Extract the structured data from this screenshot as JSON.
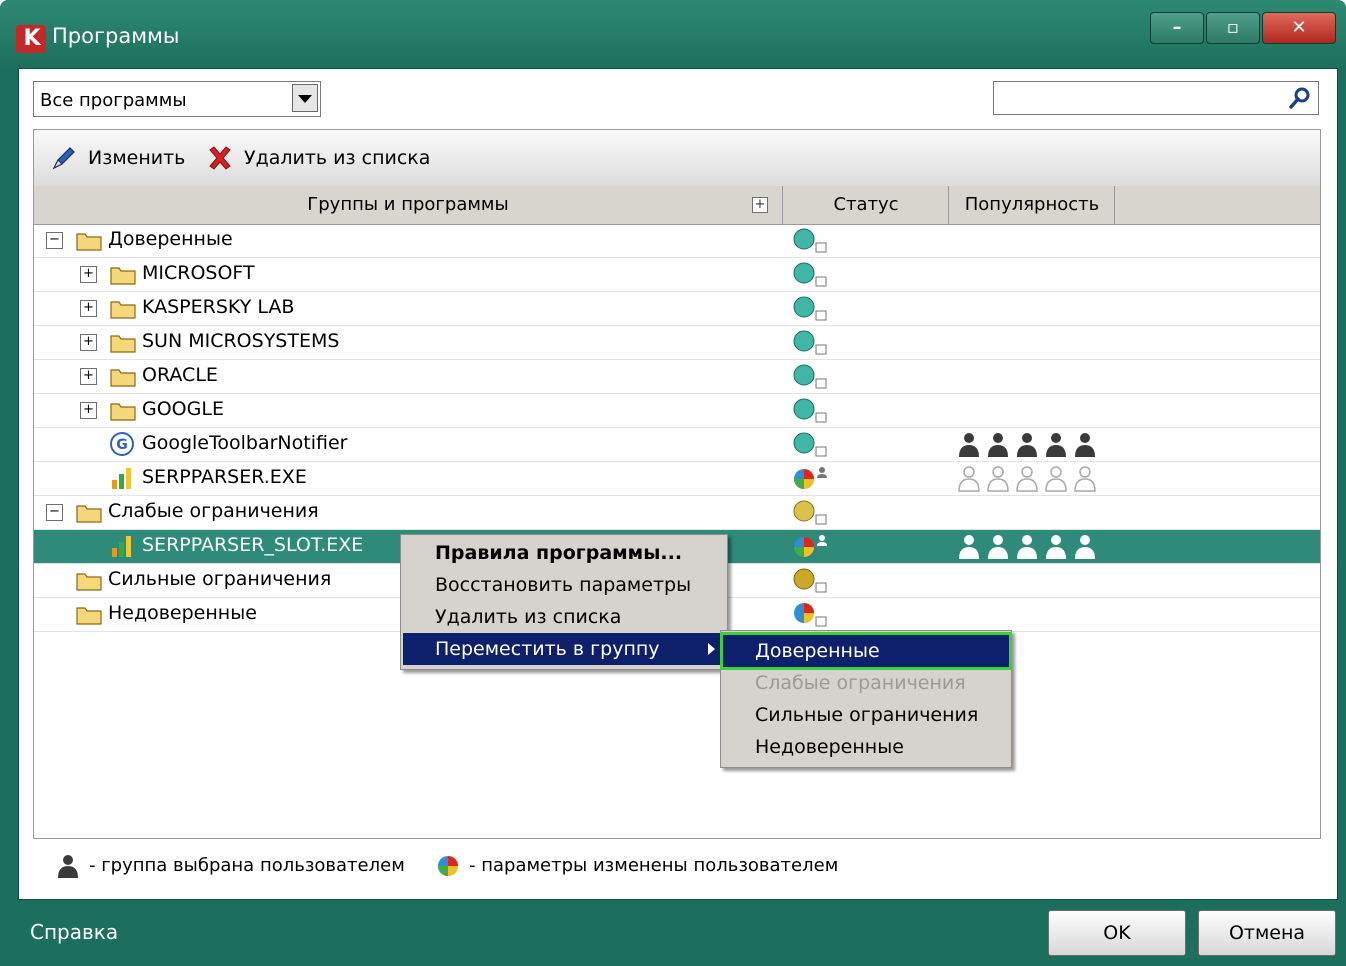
{
  "window": {
    "title": "Программы"
  },
  "filter": {
    "selected": "Все программы"
  },
  "search": {
    "value": "",
    "placeholder": ""
  },
  "toolbar": {
    "edit_label": "Изменить",
    "delete_label": "Удалить из списка"
  },
  "table": {
    "columns": [
      "Группы и программы",
      "Статус",
      "Популярность"
    ],
    "rows": [
      {
        "label": "Доверенные",
        "status": "trusted",
        "popularity": null
      },
      {
        "label": "MICROSOFT",
        "status": "trusted",
        "popularity": null
      },
      {
        "label": "KASPERSKY LAB",
        "status": "trusted",
        "popularity": null
      },
      {
        "label": "SUN MICROSYSTEMS",
        "status": "trusted",
        "popularity": null
      },
      {
        "label": "ORACLE",
        "status": "trusted",
        "popularity": null
      },
      {
        "label": "GOOGLE",
        "status": "trusted",
        "popularity": null
      },
      {
        "label": "GoogleToolbarNotifier",
        "status": "trusted",
        "popularity": 5
      },
      {
        "label": "SERPPARSER.EXE",
        "status": "modified-by-user",
        "popularity": 0
      },
      {
        "label": "Слабые ограничения",
        "status": "low-restricted",
        "popularity": null
      },
      {
        "label": "SERPPARSER_SLOT.EXE",
        "status": "modified-by-user",
        "popularity": 5,
        "selected": true
      },
      {
        "label": "Сильные ограничения",
        "status": "high-restricted",
        "popularity": null
      },
      {
        "label": "Недоверенные",
        "status": "untrusted",
        "popularity": null
      }
    ]
  },
  "context_menu": {
    "items": [
      "Правила программы...",
      "Восстановить параметры",
      "Удалить из списка",
      "Переместить в группу"
    ],
    "submenu": [
      "Доверенные",
      "Слабые ограничения",
      "Сильные ограничения",
      "Недоверенные"
    ]
  },
  "legend": {
    "user_selected": "- группа выбрана пользователем",
    "user_modified": "- параметры изменены пользователем"
  },
  "footer": {
    "help": "Справка",
    "ok": "OK",
    "cancel": "Отмена"
  },
  "colors": {
    "window": "#1c6f5c",
    "selection": "#2e8b7a",
    "menu_highlight": "#0e1f6b",
    "focus": "#3cd13c"
  }
}
